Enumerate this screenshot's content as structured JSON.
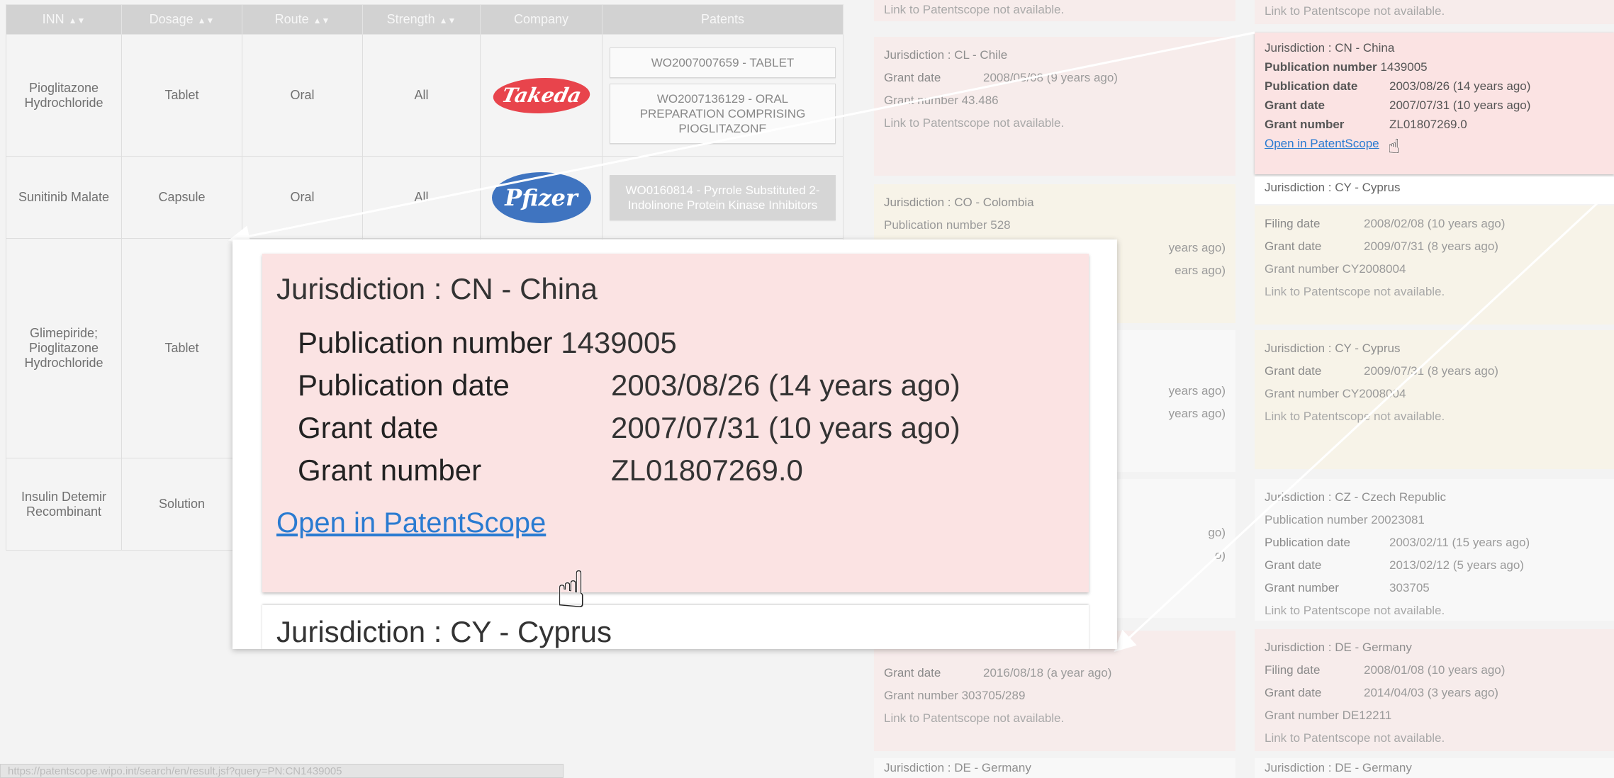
{
  "table": {
    "headers": [
      "INN",
      "Dosage",
      "Route",
      "Strength",
      "Company",
      "Patents"
    ],
    "rows": [
      {
        "inn": "Pioglitazone Hydrochloride",
        "dosage": "Tablet",
        "route": "Oral",
        "strength": "All",
        "company": "Takeda",
        "patents": [
          "WO2007007659 - TABLET",
          "WO2007136129 - ORAL PREPARATION COMPRISING PIOGLITAZONE"
        ]
      },
      {
        "inn": "Sunitinib Malate",
        "dosage": "Capsule",
        "route": "Oral",
        "strength": "All",
        "company": "Pfizer",
        "patents": [
          "WO0160814 - Pyrrole Substituted 2-Indolinone Protein Kinase Inhibitors"
        ]
      },
      {
        "inn": "Glimepiride; Pioglitazone Hydrochloride",
        "dosage": "Tablet"
      },
      {
        "inn": "Insulin Detemir Recombinant",
        "dosage": "Solution"
      }
    ]
  },
  "cards": {
    "top_na": "Link to Patentscope not available.",
    "chile": {
      "title": "Jurisdiction : CL - Chile",
      "grant_date_label": "Grant date",
      "grant_date": "2008/05/08 (9 years ago)",
      "grant_number": "Grant number 43.486",
      "na": "Link to Patentscope not available."
    },
    "colombia": {
      "title": "Jurisdiction : CO - Colombia",
      "pub_number": "Publication number 528",
      "frag1": "years ago)",
      "frag2": "ears ago)"
    },
    "frag_mid": {
      "a": "years ago)",
      "b": "years ago)"
    },
    "frag_low": {
      "a": "go)",
      "b": "o)"
    },
    "bottom_left": {
      "grant_date_label": "Grant date",
      "grant_date": "2016/08/18 (a year ago)",
      "grant_number": "Grant number 303705/289",
      "na": "Link to Patentscope not available.",
      "next": "Jurisdiction : DE - Germany"
    },
    "cy1": {
      "filing_label": "Filing date",
      "filing": "2008/02/08 (10 years ago)",
      "grant_label": "Grant date",
      "grant": "2009/07/31 (8 years ago)",
      "grant_number": "Grant number CY2008004",
      "na": "Link to Patentscope not available."
    },
    "cy2": {
      "title": "Jurisdiction : CY - Cyprus",
      "grant_label": "Grant date",
      "grant": "2009/07/31 (8 years ago)",
      "grant_number": "Grant number CY2008004",
      "na": "Link to Patentscope not available."
    },
    "cz": {
      "title": "Jurisdiction : CZ - Czech Republic",
      "pub_number": "Publication number 20023081",
      "pub_date_label": "Publication date",
      "pub_date": "2003/02/11 (15 years ago)",
      "grant_label": "Grant date",
      "grant": "2013/02/12 (5 years ago)",
      "gn_label": "Grant number",
      "gn": "303705",
      "na": "Link to Patentscope not available."
    },
    "de": {
      "title": "Jurisdiction : DE - Germany",
      "filing_label": "Filing date",
      "filing": "2008/01/08 (10 years ago)",
      "grant_label": "Grant date",
      "grant": "2014/04/03 (3 years ago)",
      "grant_number": "Grant number DE12211",
      "na": "Link to Patentscope not available.",
      "next": "Jurisdiction : DE - Germany"
    }
  },
  "china": {
    "title": "Jurisdiction : CN - China",
    "pub_number_label": "Publication number",
    "pub_number": "1439005",
    "pub_date_label": "Publication date",
    "pub_date": "2003/08/26 (14 years ago)",
    "grant_date_label": "Grant date",
    "grant_date": "2007/07/31 (10 years ago)",
    "grant_number_label": "Grant number",
    "grant_number": "ZL01807269.0",
    "link": "Open in PatentScope"
  },
  "cyprus_title": "Jurisdiction : CY - Cyprus",
  "status_url": "https://patentscope.wipo.int/search/en/result.jsf?query=PN:CN1439005",
  "icons": {
    "pointer": "hand-pointer-icon",
    "sort": "sort-icon"
  },
  "colors": {
    "card_red": "#fbe3e3",
    "link": "#2a7bd1",
    "header": "#d2d2d2"
  }
}
